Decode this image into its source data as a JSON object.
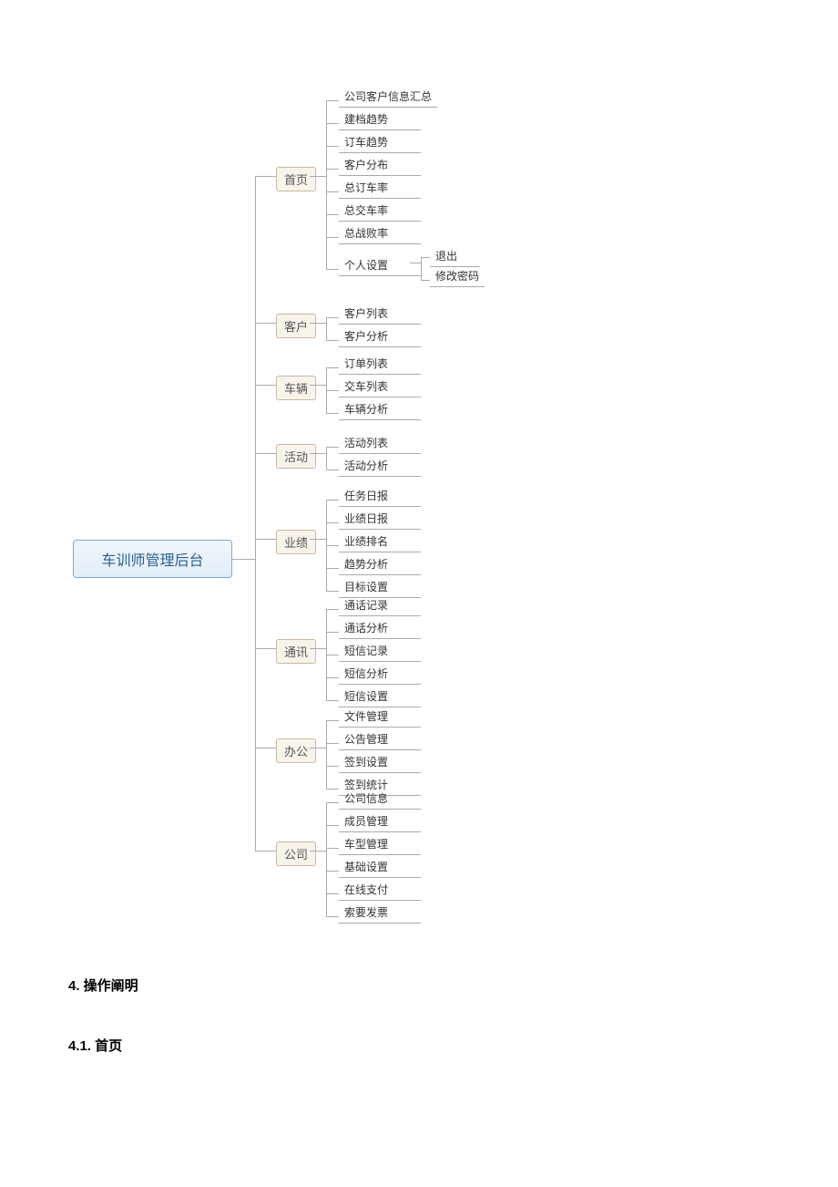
{
  "root": "车训师管理后台",
  "branches": {
    "home": "首页",
    "customer": "客户",
    "vehicle": "车辆",
    "activity": "活动",
    "performance": "业绩",
    "comm": "通讯",
    "office": "办公",
    "company": "公司"
  },
  "leaves": {
    "home": [
      "公司客户信息汇总",
      "建档趋势",
      "订车趋势",
      "客户分布",
      "总订车率",
      "总交车率",
      "总战败率",
      "个人设置"
    ],
    "home_personal": [
      "退出",
      "修改密码"
    ],
    "customer": [
      "客户列表",
      "客户分析"
    ],
    "vehicle": [
      "订单列表",
      "交车列表",
      "车辆分析"
    ],
    "activity": [
      "活动列表",
      "活动分析"
    ],
    "performance": [
      "任务日报",
      "业绩日报",
      "业绩排名",
      "趋势分析",
      "目标设置"
    ],
    "comm": [
      "通话记录",
      "通话分析",
      "短信记录",
      "短信分析",
      "短信设置"
    ],
    "office": [
      "文件管理",
      "公告管理",
      "签到设置",
      "签到统计"
    ],
    "company": [
      "公司信息",
      "成员管理",
      "车型管理",
      "基础设置",
      "在线支付",
      "索要发票"
    ]
  },
  "headings": {
    "h4": "4.   操作阐明",
    "h41": "4.1. 首页"
  }
}
